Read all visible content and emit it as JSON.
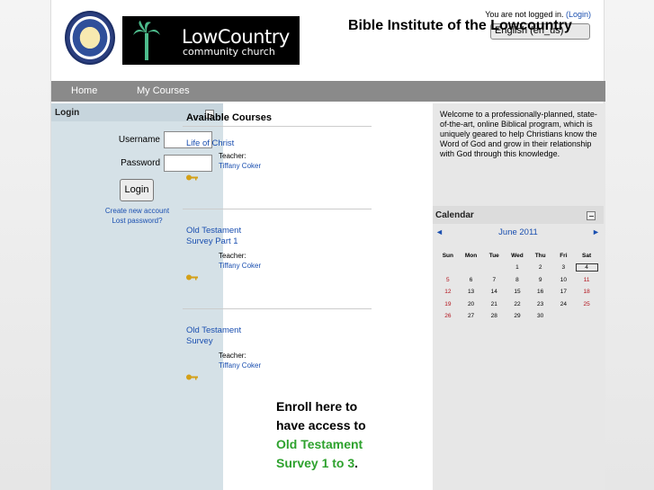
{
  "header": {
    "site_title": "Bible Institute of the Lowcountry",
    "logo_line1": "LowCountry",
    "logo_line2": "community church",
    "login_status": "You are not logged in.",
    "login_link": "(Login)",
    "language": "English (en_us)"
  },
  "nav": {
    "items": [
      "Home",
      "My Courses"
    ]
  },
  "login_block": {
    "title": "Login",
    "username_label": "Username",
    "password_label": "Password",
    "login_button": "Login",
    "create_account": "Create new account",
    "lost_password": "Lost password?"
  },
  "courses": {
    "title": "Available Courses",
    "teacher_label": "Teacher:",
    "list": [
      {
        "name_line1": "Life of Christ",
        "name_line2": "",
        "teacher": "Tiffany Coker"
      },
      {
        "name_line1": "Old Testament",
        "name_line2": "Survey Part 1",
        "teacher": "Tiffany Coker"
      },
      {
        "name_line1": "Old Testament",
        "name_line2": "Survey",
        "teacher": "Tiffany Coker"
      }
    ],
    "enroll_prefix": "Enroll here to have access to",
    "enroll_highlight": "Old Testament Survey 1 to 3",
    "enroll_suffix": "."
  },
  "welcome": "Welcome to a professionally-planned, state-of-the-art, online Biblical program, which is uniquely geared to help Christians know the Word of God and grow in their relationship with God through this knowledge.",
  "calendar": {
    "title": "Calendar",
    "month": "June 2011",
    "prev": "◄",
    "next": "►",
    "weekdays": [
      "Sun",
      "Mon",
      "Tue",
      "Wed",
      "Thu",
      "Fri",
      "Sat"
    ],
    "weeks": [
      [
        "",
        "",
        "",
        "1",
        "2",
        "3",
        "4"
      ],
      [
        "5",
        "6",
        "7",
        "8",
        "9",
        "10",
        "11"
      ],
      [
        "12",
        "13",
        "14",
        "15",
        "16",
        "17",
        "18"
      ],
      [
        "19",
        "20",
        "21",
        "22",
        "23",
        "24",
        "25"
      ],
      [
        "26",
        "27",
        "28",
        "29",
        "30",
        "",
        ""
      ]
    ],
    "today": "4",
    "weekend_color": "#b2121b"
  },
  "colors": {
    "nav_bg": "#8a8a8a",
    "link": "#1a4fb0",
    "enroll_green": "#2ea22e",
    "left_bg": "#d5e1e7"
  }
}
